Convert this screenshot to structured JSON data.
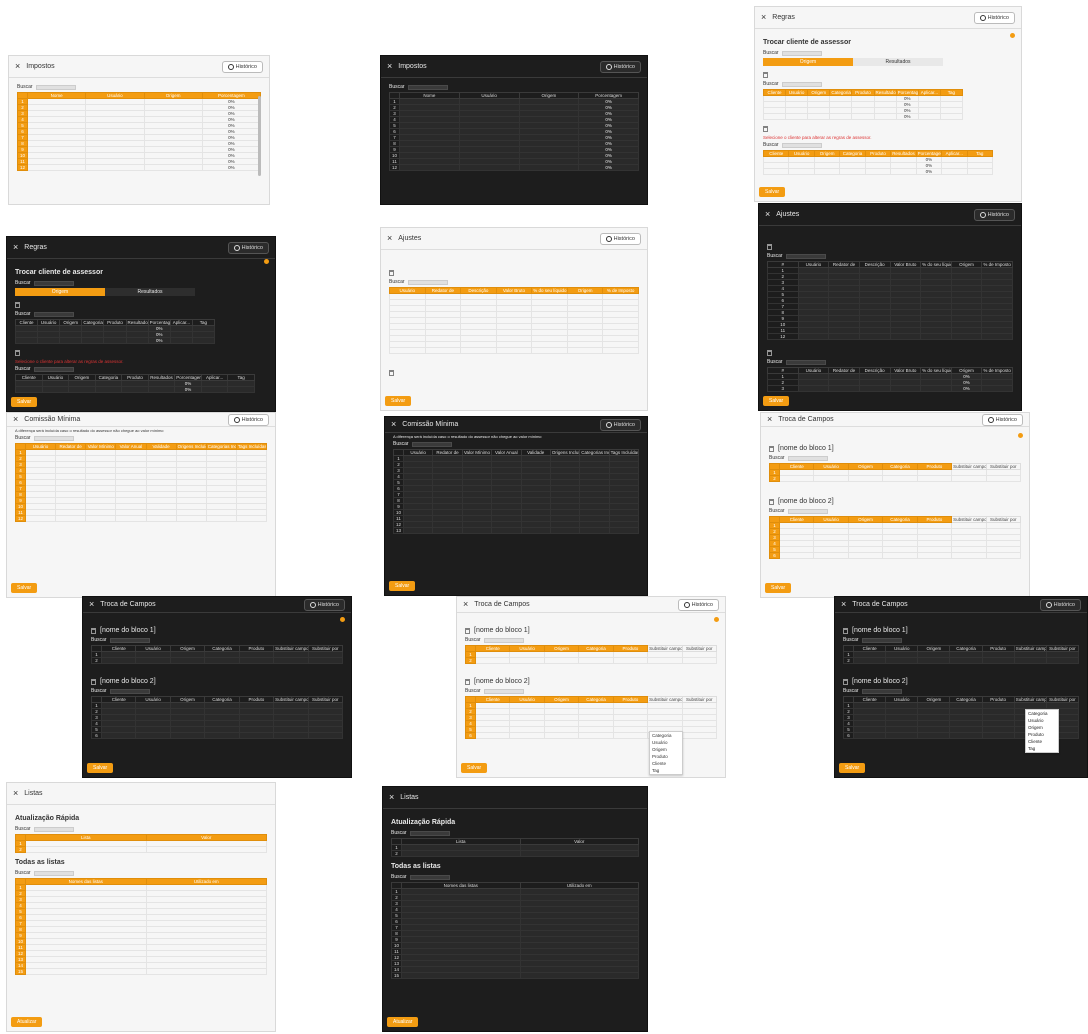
{
  "common": {
    "close_icon": "×",
    "history_label": "Histórico",
    "search_label": "Buscar",
    "save_label": "Salvar",
    "update_label": "Atualizar"
  },
  "impostos": {
    "title": "Impostos",
    "columns": [
      "Nome",
      "Usuário",
      "Origem",
      "Porcentagem"
    ],
    "rows": [
      "1",
      "2",
      "3",
      "4",
      "5",
      "6",
      "7",
      "8",
      "9",
      "10",
      "11",
      "12"
    ],
    "pct": "0%"
  },
  "regras": {
    "title": "Regras",
    "section": "Trocar cliente de assessor",
    "tabs": [
      "Origem",
      "Resultados"
    ],
    "cols_a": [
      "Cliente",
      "Usuário",
      "Origem",
      "Categoria",
      "Produto",
      "Resultados",
      "Porcentagem",
      "Aplicar...",
      "Tag"
    ],
    "cols_b": [
      "Cliente",
      "Usuário",
      "Origem",
      "Categoria",
      "Produto",
      "Resultados",
      "Porcentagem",
      "Aplicar...",
      "Tag"
    ],
    "pct": "0%",
    "warning": "Selecione o cliente para alterar as regras de assessor."
  },
  "ajustes": {
    "title": "Ajustes",
    "columns": [
      "#",
      "Usuário",
      "Redator de",
      "Descrição",
      "Valor Bruto",
      "% do seu líquido",
      "Origem",
      "% de Imposto"
    ],
    "columns_light": [
      "Usuário",
      "Redator de",
      "Descrição",
      "Valor Bruto",
      "% do seu líquido",
      "Origem",
      "% de Imposto"
    ],
    "rows": [
      "1",
      "2",
      "3",
      "4",
      "5",
      "6",
      "7",
      "8",
      "9",
      "10",
      "11",
      "12"
    ],
    "pct": "0%"
  },
  "comissao": {
    "title": "Comissão Mínima",
    "note": "A diferença será incluída caso o resultado do assessor não chegue ao valor mínimo",
    "columns": [
      "Usuário",
      "Redator de",
      "Valor Mínimo",
      "Valor Anual",
      "Validade",
      "Origens Incluídas",
      "Categorias Incluí...",
      "Tags Incluídas"
    ],
    "rows": [
      "1",
      "2",
      "3",
      "4",
      "5",
      "6",
      "7",
      "8",
      "9",
      "10",
      "11",
      "12",
      "13"
    ]
  },
  "troca": {
    "title": "Troca de Campos",
    "block1": "[nome do bloco 1]",
    "block2": "[nome do bloco 2]",
    "columns": [
      "Cliente",
      "Usuário",
      "Origem",
      "Categoria",
      "Produto",
      "Substituir campo",
      "Substituir por"
    ],
    "dropdown": [
      "Categoria",
      "Usuário",
      "Origem",
      "Produto",
      "Cliente",
      "Tag"
    ]
  },
  "listas": {
    "title": "Listas",
    "quick": "Atualização Rápida",
    "quick_cols": [
      "Lista",
      "Valor"
    ],
    "all": "Todas as listas",
    "all_cols": [
      "Nomes das listas",
      "Utilizado em"
    ],
    "rows": [
      "1",
      "2",
      "3",
      "4",
      "5",
      "6",
      "7",
      "8",
      "9",
      "10",
      "11",
      "12",
      "13",
      "14",
      "15"
    ]
  }
}
